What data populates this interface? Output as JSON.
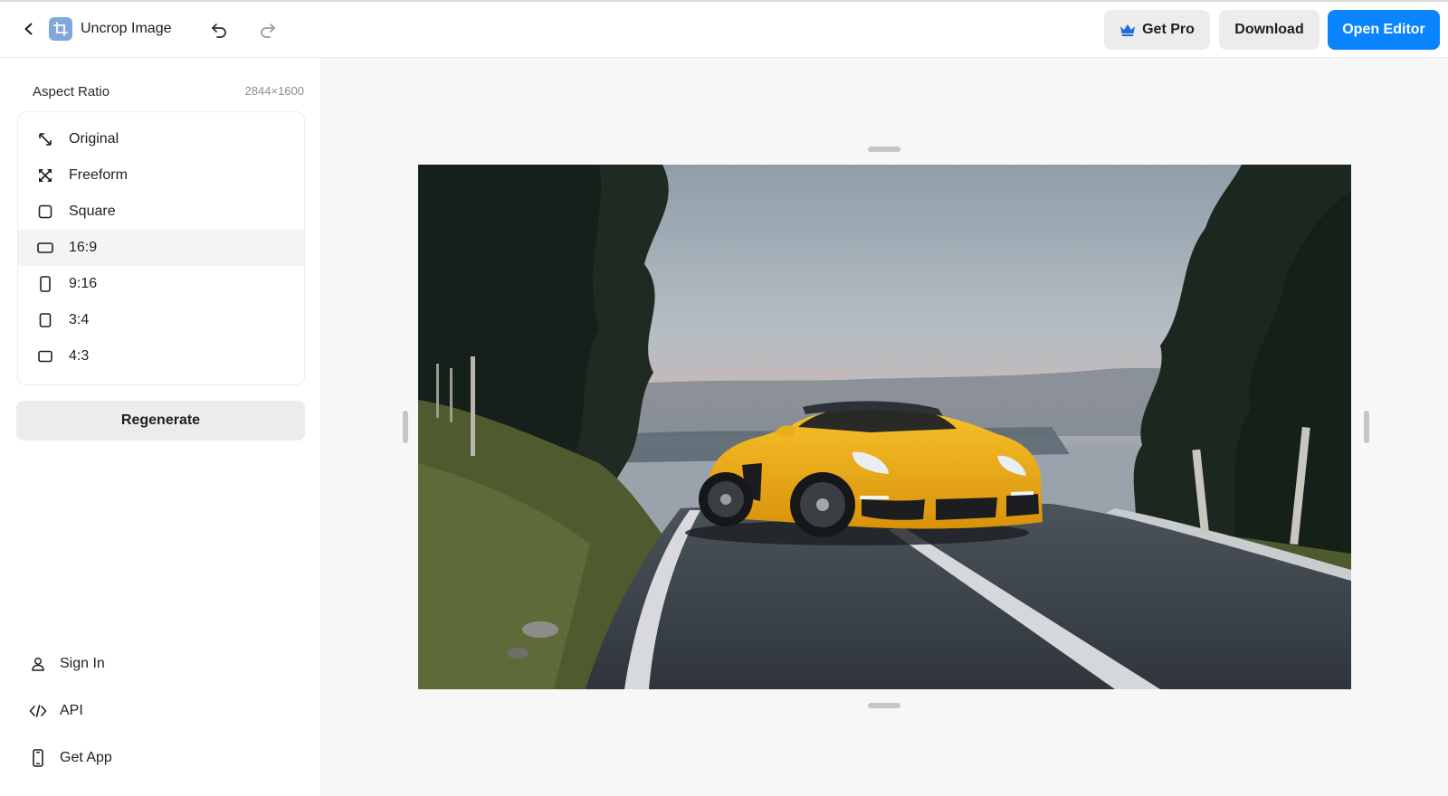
{
  "header": {
    "title": "Uncrop Image",
    "get_pro_label": "Get Pro",
    "download_label": "Download",
    "open_editor_label": "Open Editor",
    "accent_color": "#0a84ff",
    "icons": [
      "back-icon",
      "crop-icon",
      "undo-icon",
      "redo-icon",
      "crown-icon"
    ]
  },
  "sidebar": {
    "aspect_ratio_label": "Aspect Ratio",
    "dimensions": "2844×1600",
    "ratios": [
      {
        "label": "Original",
        "icon": "expand-diagonal-icon"
      },
      {
        "label": "Freeform",
        "icon": "freeform-arrows-icon"
      },
      {
        "label": "Square",
        "icon": "square-icon"
      },
      {
        "label": "16:9",
        "icon": "landscape-rect-icon",
        "selected": true
      },
      {
        "label": "9:16",
        "icon": "portrait-rect-icon"
      },
      {
        "label": "3:4",
        "icon": "portrait-rect-icon"
      },
      {
        "label": "4:3",
        "icon": "landscape-rect-icon"
      }
    ],
    "regenerate_label": "Regenerate",
    "footer": [
      {
        "label": "Sign In",
        "icon": "user-icon"
      },
      {
        "label": "API",
        "icon": "code-icon"
      },
      {
        "label": "Get App",
        "icon": "phone-icon"
      }
    ]
  },
  "canvas": {
    "image_subject": "yellow convertible sports car on a rural road",
    "background_color": "#f7f7f7"
  }
}
